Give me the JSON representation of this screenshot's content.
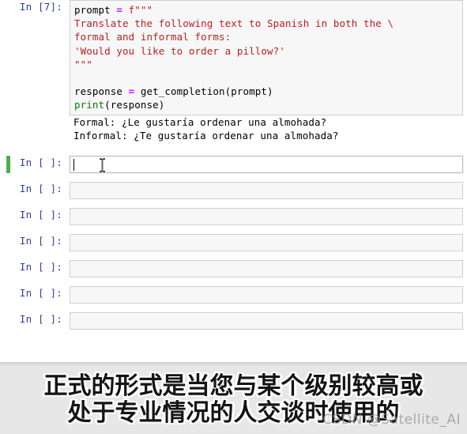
{
  "notebook": {
    "executed_cell": {
      "prompt_label": "In [7]:",
      "code_lines": [
        [
          {
            "t": "plain",
            "v": "prompt "
          },
          {
            "t": "op",
            "v": "="
          },
          {
            "t": "str",
            "v": " f\"\"\""
          }
        ],
        [
          {
            "t": "str",
            "v": "Translate the following text to Spanish in both the \\"
          }
        ],
        [
          {
            "t": "str",
            "v": "formal and informal forms:"
          }
        ],
        [
          {
            "t": "str",
            "v": "'Would you like to order a pillow?'"
          }
        ],
        [
          {
            "t": "str",
            "v": "\"\"\""
          }
        ],
        [
          {
            "t": "plain",
            "v": ""
          }
        ],
        [
          {
            "t": "plain",
            "v": "response "
          },
          {
            "t": "op",
            "v": "="
          },
          {
            "t": "plain",
            "v": " get_completion(prompt)"
          }
        ],
        [
          {
            "t": "bi",
            "v": "print"
          },
          {
            "t": "plain",
            "v": "(response)"
          }
        ]
      ]
    },
    "output": {
      "prompt_label": "",
      "lines": [
        "Formal: ¿Le gustaría ordenar una almohada?",
        "Informal: ¿Te gustaría ordenar una almohada?"
      ]
    },
    "active_cell": {
      "prompt_label": "In [ ]:",
      "value": "",
      "caret_visible": true,
      "selected_bar_color": "#4caf50"
    },
    "empty_cells": [
      {
        "prompt_label": "In [ ]:",
        "value": ""
      },
      {
        "prompt_label": "In [ ]:",
        "value": ""
      },
      {
        "prompt_label": "In [ ]:",
        "value": ""
      },
      {
        "prompt_label": "In [ ]:",
        "value": ""
      },
      {
        "prompt_label": "In [ ]:",
        "value": ""
      },
      {
        "prompt_label": "In [ ]:",
        "value": ""
      }
    ]
  },
  "subtitle": {
    "line1": "正式的形式是当您与某个级别较高或",
    "line2": "处于专业情况的人交谈时使用的",
    "watermark": "CSDN @Satellite_AI"
  },
  "colors": {
    "prompt": "#303F9F",
    "string": "#BA2121",
    "operator": "#AA22FF",
    "builtin": "#008000",
    "run_bar": "#4caf50",
    "cell_bg": "#f7f7f7",
    "subtitle_bg": "#e7e7e7"
  }
}
